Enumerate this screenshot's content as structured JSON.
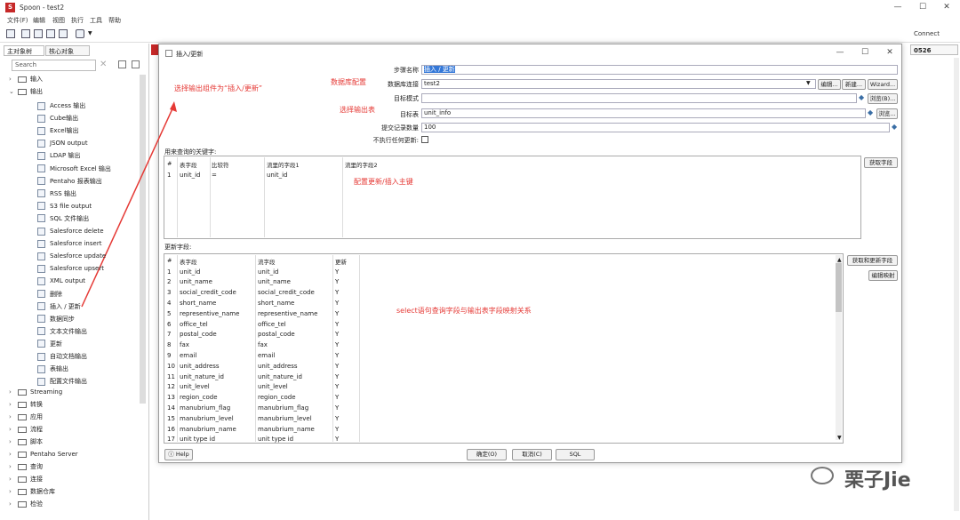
{
  "app": {
    "title": "Spoon - test2",
    "icon_text": "S"
  },
  "window_controls": {
    "minimize": "—",
    "maximize": "☐",
    "close": "✕"
  },
  "menu": [
    "文件(F)",
    "编辑",
    "视图",
    "执行",
    "工具",
    "帮助"
  ],
  "toolbar": {
    "connect": "Connect"
  },
  "left_panel": {
    "tabs": [
      "主对象树",
      "核心对象"
    ],
    "search_placeholder": "Search",
    "folders_top": [
      "输入",
      "输出"
    ],
    "output_items": [
      "Access 输出",
      "Cube输出",
      "Excel输出",
      "JSON output",
      "LDAP 输出",
      "Microsoft Excel 输出",
      "Pentaho 报表输出",
      "RSS 输出",
      "S3 file output",
      "SQL 文件输出",
      "Salesforce delete",
      "Salesforce insert",
      "Salesforce update",
      "Salesforce upsert",
      "XML output",
      "删除",
      "插入 / 更新",
      "数据同步",
      "文本文件输出",
      "更新",
      "自动文档输出",
      "表输出",
      "配置文件输出"
    ],
    "folders_bottom": [
      "Streaming",
      "转换",
      "应用",
      "流程",
      "脚本",
      "Pentaho Server",
      "查询",
      "连接",
      "数据仓库",
      "检验"
    ]
  },
  "right_tab": "0526",
  "dialog": {
    "title": "插入/更新",
    "step_name_label": "步骤名称",
    "step_name_value": "插入 / 更新",
    "db_conn_label": "数据库连接",
    "db_conn_value": "test2",
    "target_schema_label": "目标模式",
    "target_schema_value": "",
    "target_table_label": "目标表",
    "target_table_value": "unit_info",
    "commit_size_label": "提交记录数量",
    "commit_size_value": "100",
    "no_update_label": "不执行任何更新:",
    "buttons": {
      "edit": "编辑...",
      "new": "新建...",
      "wizard": "Wizard...",
      "browse_schema": "浏览(B)...",
      "browse_table": "浏览...",
      "get_fields": "获取字段",
      "get_update_fields": "获取和更新字段",
      "edit_mapping": "编辑映射",
      "ok": "确定(O)",
      "cancel": "取消(C)",
      "sql": "SQL",
      "help": "Help"
    },
    "key_section_label": "用来查询的关键字:",
    "key_columns": [
      "#",
      "表字段",
      "比较符",
      "流里的字段1",
      "流里的字段2"
    ],
    "key_rows": [
      [
        "1",
        "unit_id",
        "=",
        "unit_id",
        ""
      ]
    ],
    "update_section_label": "更新字段:",
    "update_columns": [
      "#",
      "表字段",
      "流字段",
      "更新"
    ],
    "update_rows": [
      [
        "1",
        "unit_id",
        "unit_id",
        "Y"
      ],
      [
        "2",
        "unit_name",
        "unit_name",
        "Y"
      ],
      [
        "3",
        "social_credit_code",
        "social_credit_code",
        "Y"
      ],
      [
        "4",
        "short_name",
        "short_name",
        "Y"
      ],
      [
        "5",
        "representive_name",
        "representive_name",
        "Y"
      ],
      [
        "6",
        "office_tel",
        "office_tel",
        "Y"
      ],
      [
        "7",
        "postal_code",
        "postal_code",
        "Y"
      ],
      [
        "8",
        "fax",
        "fax",
        "Y"
      ],
      [
        "9",
        "email",
        "email",
        "Y"
      ],
      [
        "10",
        "unit_address",
        "unit_address",
        "Y"
      ],
      [
        "11",
        "unit_nature_id",
        "unit_nature_id",
        "Y"
      ],
      [
        "12",
        "unit_level",
        "unit_level",
        "Y"
      ],
      [
        "13",
        "region_code",
        "region_code",
        "Y"
      ],
      [
        "14",
        "manubrium_flag",
        "manubrium_flag",
        "Y"
      ],
      [
        "15",
        "manubrium_level",
        "manubrium_level",
        "Y"
      ],
      [
        "16",
        "manubrium_name",
        "manubrium_name",
        "Y"
      ],
      [
        "17",
        "unit type id",
        "unit type id",
        "Y"
      ]
    ]
  },
  "annotations": {
    "choose_component": "选择输出组件为“插入/更新”",
    "db_config": "数据库配置",
    "choose_table": "选择输出表",
    "config_key": "配置更新/插入主键",
    "mapping": "select语句查询字段与输出表字段映射关系"
  },
  "watermark": "栗子Jie",
  "colors": {
    "annotation": "#e53935",
    "app_icon": "#c62828"
  }
}
